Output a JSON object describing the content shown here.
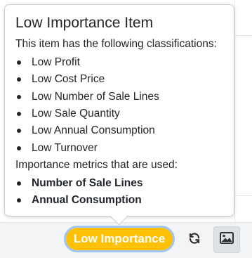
{
  "popover": {
    "title": "Low Importance Item",
    "intro": "This item has the following classifications:",
    "classifications": [
      "Low Profit",
      "Low Cost Price",
      "Low Number of Sale Lines",
      "Low Sale Quantity",
      "Low Annual Consumption",
      "Low Turnover"
    ],
    "metrics_intro": "Importance metrics that are used:",
    "metrics": [
      "Number of Sale Lines",
      "Annual Consumption"
    ]
  },
  "toolbar": {
    "badge_label": "Low Importance",
    "refresh_icon": "refresh-icon",
    "image_icon": "image-icon"
  },
  "colors": {
    "badge_bg": "#ffc107",
    "badge_focus_ring": "#9ec5fe",
    "toolbar_bg": "#f2f4f6"
  }
}
